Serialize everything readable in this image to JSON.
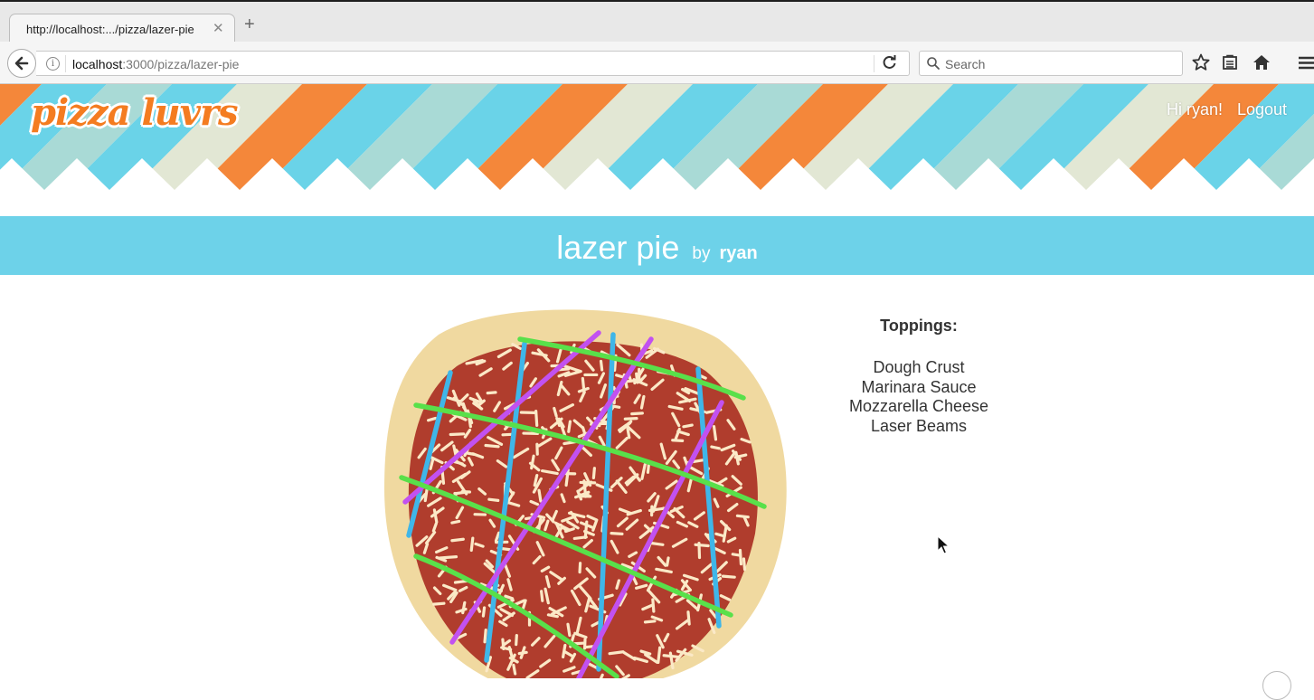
{
  "browser": {
    "tab_title": "http://localhost:.../pizza/lazer-pie",
    "tab_close_glyph": "✕",
    "new_tab_glyph": "+",
    "url_host": "localhost",
    "url_path": ":3000/pizza/lazer-pie",
    "search_placeholder": "Search",
    "icons": [
      "back-arrow-icon",
      "info-icon",
      "reload-icon",
      "search-icon",
      "bookmark-star-icon",
      "reading-list-icon",
      "home-icon",
      "menu-icon"
    ]
  },
  "site": {
    "logo": "pizza luvrs",
    "greeting": "Hi ryan!",
    "logout": "Logout",
    "stripe_colors": [
      "#e2e7d4",
      "#f4873a",
      "#6ad3e8",
      "#a9dad6"
    ]
  },
  "page": {
    "pizza_name": "lazer pie",
    "by_label": "by",
    "author": "ryan",
    "band_color": "#6dd2e9"
  },
  "toppings": {
    "heading": "Toppings:",
    "items": [
      "Dough Crust",
      "Marinara Sauce",
      "Mozzarella Cheese",
      "Laser Beams"
    ]
  },
  "pizza_colors": {
    "crust": "#f0d9a0",
    "sauce": "#b03d2d",
    "cheese": "#fbe9c7",
    "laser_green": "#59e04a",
    "laser_purple": "#c251f0",
    "laser_blue": "#3fb6e8"
  }
}
